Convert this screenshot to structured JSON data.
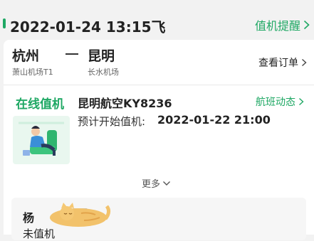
{
  "header": {
    "date_time": "2022-01-24 13:15飞",
    "remind_label": "值机提醒"
  },
  "route": {
    "departure_city": "杭州",
    "departure_airport": "萧山机场T1",
    "arrival_city": "昆明",
    "arrival_airport": "长水机场",
    "view_order_label": "查看订单"
  },
  "checkin": {
    "title": "在线值机",
    "flight": "昆明航空KY8236",
    "flight_dynamic_label": "航班动态",
    "start_label": "预计开始值机:",
    "start_time": "2022-01-22 21:00",
    "more_label": "更多"
  },
  "passenger": {
    "name": "杨",
    "tag": "人",
    "status": "未值机"
  },
  "colors": {
    "accent": "#1fa864",
    "background": "#f2f2f2",
    "card": "#ffffff"
  },
  "icons": {
    "remind": "chevron-right-icon",
    "order": "chevron-right-icon",
    "dynamic": "chevron-right-icon",
    "more": "chevron-down-icon"
  }
}
